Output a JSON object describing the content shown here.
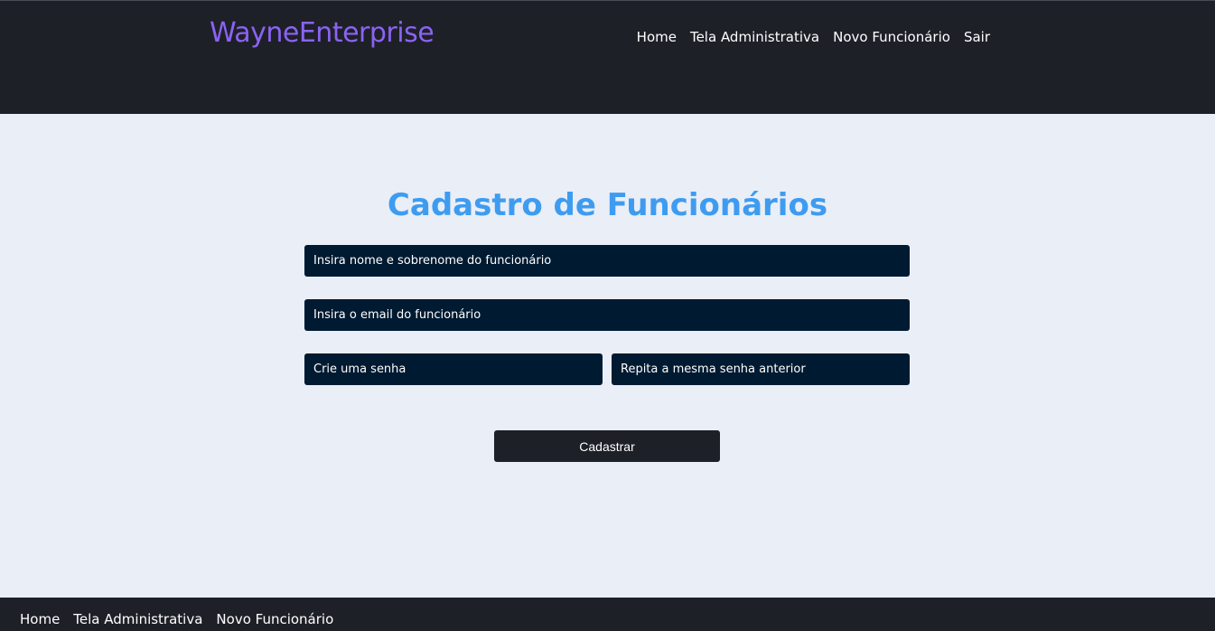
{
  "header": {
    "brand": "WayneEnterprise",
    "nav": [
      "Home",
      "Tela Administrativa",
      "Novo Funcionário",
      "Sair"
    ]
  },
  "form": {
    "title": "Cadastro de Funcionários",
    "name_placeholder": "Insira nome e sobrenome do funcionário",
    "email_placeholder": "Insira o email do funcionário",
    "password_placeholder": "Crie uma senha",
    "password_confirm_placeholder": "Repita a mesma senha anterior",
    "submit_label": "Cadastrar"
  },
  "footer": {
    "nav": [
      "Home",
      "Tela Administrativa",
      "Novo Funcionário"
    ]
  },
  "colors": {
    "header_bg": "#1e2028",
    "brand": "#8b63f2",
    "title": "#3e9cf0",
    "input_bg": "#001a31",
    "page_bg": "#e9eef7"
  }
}
